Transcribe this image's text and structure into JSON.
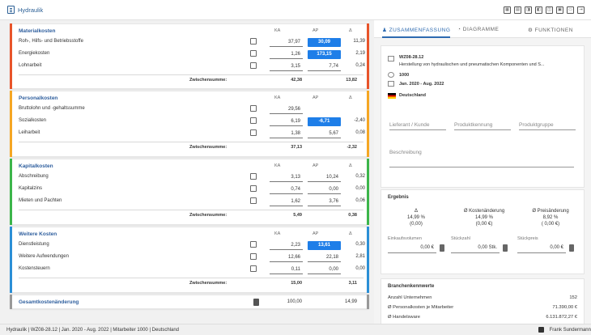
{
  "app": {
    "title": "Hydraulik"
  },
  "toolbar": {
    "icons": [
      "calculator-icon",
      "grid-icon",
      "copy-icon",
      "paste-icon",
      "export-icon",
      "image-icon",
      "print-icon",
      "exit-icon"
    ],
    "icon_glyphs": [
      "▦",
      "▤",
      "◨",
      "◧",
      "◫",
      "▣",
      "▭",
      "⇥"
    ]
  },
  "sections": [
    {
      "title": "Materialkosten",
      "color": "#e8542a",
      "col_ka": "KA",
      "col_ap": "AP",
      "col_delta": "Δ",
      "rows": [
        {
          "label": "Roh-, Hilfs- und Betriebsstoffe",
          "ka": "37,97",
          "ap": "30,09",
          "delta": "11,39",
          "ap_highlight": true
        },
        {
          "label": "Energiekosten",
          "ka": "1,26",
          "ap": "173,15",
          "delta": "2,19",
          "ap_highlight": true
        },
        {
          "label": "Lohnarbeit",
          "ka": "3,15",
          "ap": "7,74",
          "delta": "0,24",
          "ap_highlight": false
        }
      ],
      "sum_label": "Zwischensumme:",
      "sum_ka": "42,38",
      "sum_delta": "13,82"
    },
    {
      "title": "Personalkosten",
      "color": "#f5a623",
      "col_ka": "KA",
      "col_ap": "AP",
      "col_delta": "Δ",
      "rows": [
        {
          "label": "Bruttolohn und -gehaltssumme",
          "ka": "29,56",
          "ap": "",
          "delta": "",
          "ap_highlight": false
        },
        {
          "label": "Sozialkosten",
          "ka": "6,19",
          "ap": "-6,71",
          "delta": "-2,40",
          "ap_highlight": true
        },
        {
          "label": "Leiharbeit",
          "ka": "1,38",
          "ap": "5,67",
          "delta": "0,08",
          "ap_highlight": false
        }
      ],
      "sum_label": "Zwischensumme:",
      "sum_ka": "37,13",
      "sum_delta": "-2,32"
    },
    {
      "title": "Kapitalkosten",
      "color": "#3cb54a",
      "col_ka": "KA",
      "col_ap": "AP",
      "col_delta": "Δ",
      "rows": [
        {
          "label": "Abschreibung",
          "ka": "3,13",
          "ap": "10,24",
          "delta": "0,32",
          "ap_highlight": false
        },
        {
          "label": "Kapitalzins",
          "ka": "0,74",
          "ap": "0,00",
          "delta": "0,00",
          "ap_highlight": false
        },
        {
          "label": "Mieten und Pachten",
          "ka": "1,62",
          "ap": "3,76",
          "delta": "0,06",
          "ap_highlight": false
        }
      ],
      "sum_label": "Zwischensumme:",
      "sum_ka": "5,49",
      "sum_delta": "0,38"
    },
    {
      "title": "Weitere Kosten",
      "color": "#2b8fd6",
      "col_ka": "KA",
      "col_ap": "AP",
      "col_delta": "Δ",
      "rows": [
        {
          "label": "Dienstleistung",
          "ka": "2,23",
          "ap": "13,61",
          "delta": "0,30",
          "ap_highlight": true
        },
        {
          "label": "Weitere Aufwendungen",
          "ka": "12,66",
          "ap": "22,18",
          "delta": "2,81",
          "ap_highlight": false
        },
        {
          "label": "Kostensteuern",
          "ka": "0,11",
          "ap": "0,00",
          "delta": "0,00",
          "ap_highlight": false
        }
      ],
      "sum_label": "Zwischensumme:",
      "sum_ka": "15,00",
      "sum_delta": "3,11"
    }
  ],
  "total": {
    "label": "Gesamtkostenänderung",
    "ka": "100,00",
    "delta": "14,99",
    "color": "#999999"
  },
  "tabs": [
    {
      "label": "ZUSAMMENFASSUNG",
      "icon": "person-icon",
      "glyph": "♟"
    },
    {
      "label": "DIAGRAMME",
      "icon": "pie-chart-icon",
      "glyph": "◔"
    },
    {
      "label": "FUNKTIONEN",
      "icon": "gear-icon",
      "glyph": "⚙"
    }
  ],
  "summary": {
    "code": "WZ08-28.12",
    "description": "Herstellung von hydraulischen und pneumatischen Komponenten und S...",
    "employees": "1000",
    "period": "Jan. 2020 - Aug. 2022",
    "country": "Deutschland"
  },
  "fields": {
    "supplier": "Lieferant / Kunde",
    "product_id": "Produktkennung",
    "product_group": "Produktgruppe",
    "description": "Beschreibung"
  },
  "result": {
    "title": "Ergebnis",
    "cols": [
      {
        "head": "Δ",
        "line1": "14,99 %",
        "line2": "(0,00)"
      },
      {
        "head": "Ø Kostenänderung",
        "line1": "14,99 %",
        "line2": "(0,00 €)"
      },
      {
        "head": "Ø Preisänderung",
        "line1": "8,92 %",
        "line2": "( 0,00 €)"
      }
    ],
    "inputs": [
      {
        "label": "Einkaufsvolumen",
        "value": "0,00 €"
      },
      {
        "label": "Stückzahl",
        "value": "0,00 Stk."
      },
      {
        "label": "Stückpreis",
        "value": "0,00 €"
      }
    ]
  },
  "branch": {
    "title": "Branchenkennwerte",
    "rows": [
      {
        "label": "Anzahl Unternehmen",
        "value": "152"
      },
      {
        "label": "Ø Personalkosten je Mitarbeiter",
        "value": "71.390,00 €"
      },
      {
        "label": "Ø Handelsware",
        "value": "6.131.872,27 €"
      }
    ]
  },
  "status": {
    "text": "Hydraulik | WZ08-28.12 | Jan. 2020 - Aug. 2022 | Mitarbeiter 1000 | Deutschland",
    "user": "Frank Sundermann"
  }
}
